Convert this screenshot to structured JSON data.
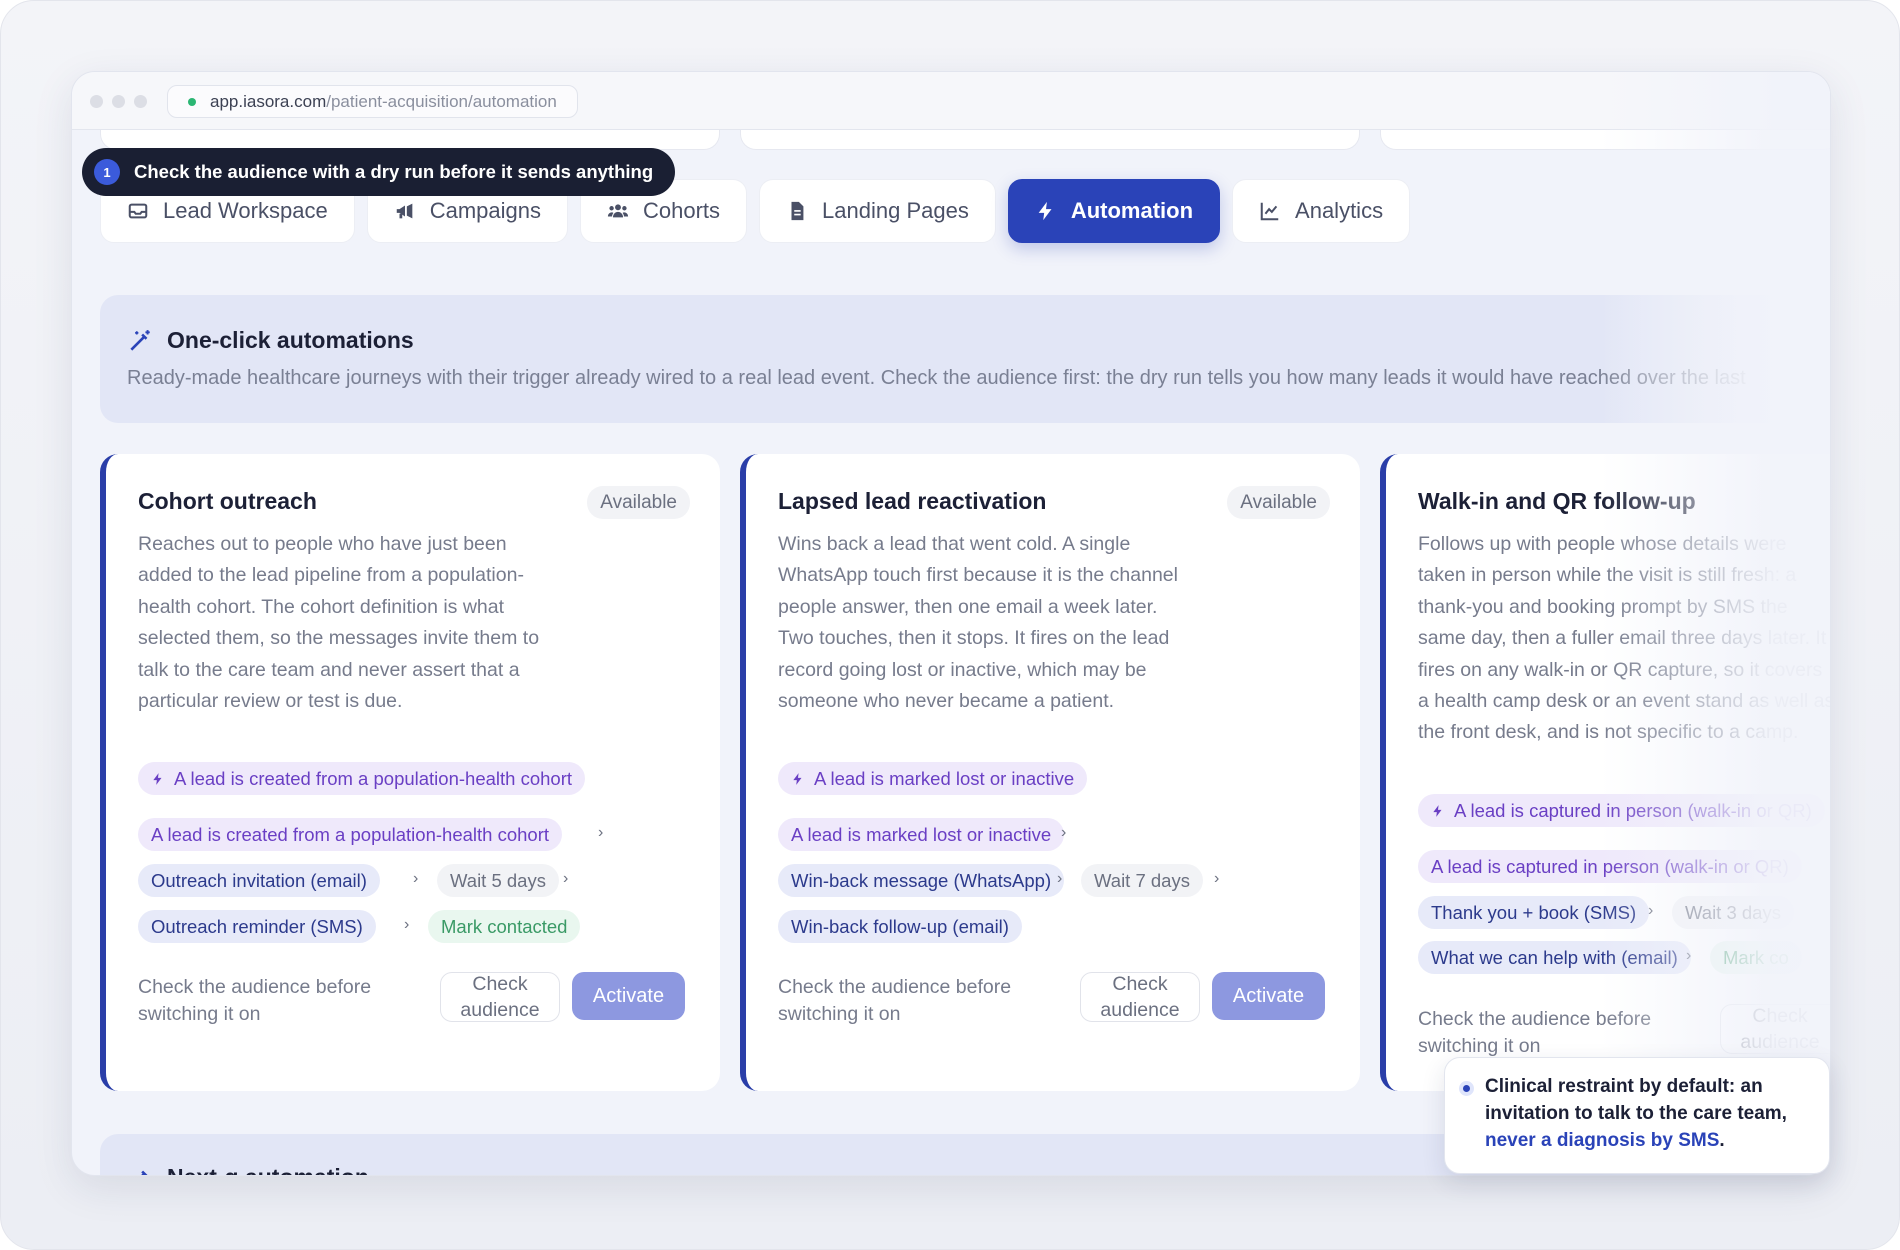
{
  "browser": {
    "url_host": "app.iasora.com",
    "url_path": "/patient-acquisition/automation"
  },
  "tooltip": {
    "step": "1",
    "text": "Check the audience with a dry run before it sends anything"
  },
  "tabs": [
    {
      "label": "Lead Workspace",
      "icon": "inbox-icon"
    },
    {
      "label": "Campaigns",
      "icon": "megaphone-icon"
    },
    {
      "label": "Cohorts",
      "icon": "users-icon"
    },
    {
      "label": "Landing Pages",
      "icon": "file-icon"
    },
    {
      "label": "Automation",
      "icon": "bolt-icon",
      "active": true
    },
    {
      "label": "Analytics",
      "icon": "chart-line-icon"
    }
  ],
  "banner": {
    "title": "One-click automations",
    "subtitle": "Ready-made healthcare journeys with their trigger already wired to a real lead event. Check the audience first: the dry run tells you how many leads it would have reached over the last"
  },
  "cards": [
    {
      "title": "Cohort outreach",
      "badge": "Available",
      "description": "Reaches out to people who have just been added to the lead pipeline from a population-health cohort. The cohort definition is what selected them, so the messages invite them to talk to the care team and never assert that a particular review or test is due.",
      "trigger": "A lead is created from a population-health cohort",
      "flow_trigger": "A lead is created from a population-health cohort",
      "step1": "Outreach invitation (email)",
      "wait": "Wait 5 days",
      "step2": "Outreach reminder (SMS)",
      "final": "Mark contacted",
      "check_note": "Check the audience before switching it on",
      "check_label": "Check audience",
      "activate_label": "Activate"
    },
    {
      "title": "Lapsed lead reactivation",
      "badge": "Available",
      "description": "Wins back a lead that went cold. A single WhatsApp touch first because it is the channel people answer, then one email a week later. Two touches, then it stops. It fires on the lead record going lost or inactive, which may be someone who never became a patient.",
      "trigger": "A lead is marked lost or inactive",
      "flow_trigger": "A lead is marked lost or inactive",
      "step1": "Win-back message (WhatsApp)",
      "wait": "Wait 7 days",
      "step2": "Win-back follow-up (email)",
      "check_note": "Check the audience before switching it on",
      "check_label": "Check audience",
      "activate_label": "Activate"
    },
    {
      "title": "Walk-in and QR follow-up",
      "description": "Follows up with people whose details were taken in person while the visit is still fresh: a thank-you and booking prompt by SMS the same day, then a fuller email three days later. It fires on any walk-in or QR capture, so it covers a health camp desk or an event stand as well as the front desk, and is not specific to a camp.",
      "trigger": "A lead is captured in person (walk-in or QR)",
      "flow_trigger": "A lead is captured in person (walk-in or QR)",
      "step1": "Thank you + book (SMS)",
      "wait": "Wait 3 days",
      "step2": "What we can help with (email)",
      "final": "Mark co",
      "check_note": "Check the audience before switching it on",
      "check_label": "Check audience"
    }
  ],
  "next_section": {
    "title": "Next-g automation"
  },
  "callout": {
    "text_before": "Clinical restraint by default: an invitation to talk to the care team, ",
    "highlight": "never a diagnosis by SMS",
    "text_after": "."
  }
}
